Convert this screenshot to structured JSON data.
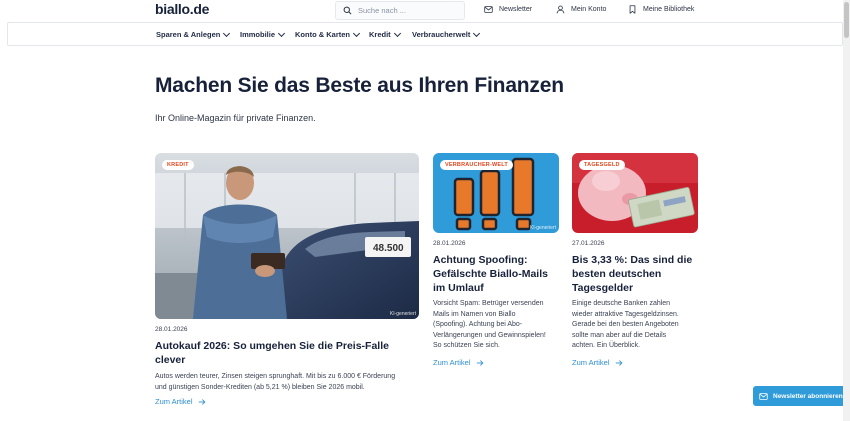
{
  "header": {
    "logo": "biallo.de",
    "search_placeholder": "Suche nach ...",
    "links": {
      "newsletter": "Newsletter",
      "account": "Mein Konto",
      "library": "Meine Bibliothek"
    }
  },
  "nav": {
    "items": [
      {
        "label": "Sparen & Anlegen"
      },
      {
        "label": "Immobilie"
      },
      {
        "label": "Konto & Karten"
      },
      {
        "label": "Kredit"
      },
      {
        "label": "Verbraucherwelt"
      }
    ]
  },
  "hero": {
    "title": "Machen Sie das Beste aus Ihren Finanzen",
    "subtitle": "Ihr Online-Magazin für private Finanzen."
  },
  "articles": [
    {
      "tag": "KREDIT",
      "credit": "KI-generiert",
      "plate": "48.500",
      "date": "28.01.2026",
      "title": "Autokauf 2026: So umgehen Sie die Preis-Falle clever",
      "title_line1": "Autokauf 2026: So umgehen Sie die Preis-Falle",
      "title_line2": "clever",
      "text_line1": "Autos werden teurer, Zinsen steigen sprunghaft. Mit bis zu 6.000 € Förderung",
      "text_line2": "und günstigen Sonder-Krediten (ab 5,21 %) bleiben Sie 2026 mobil.",
      "link": "Zum Artikel"
    },
    {
      "tag": "VERBRAUCHER-WELT",
      "credit": "KI-generiert",
      "date": "28.01.2026",
      "title_lines": [
        "Achtung Spoofing:",
        "Gefälschte Biallo-Mails",
        "im Umlauf"
      ],
      "text_lines": [
        "Vorsicht Spam: Betrüger versenden",
        "Mails im Namen von Biallo",
        "(Spoofing). Achtung bei Abo-",
        "Verlängerungen und Gewinnspielen!",
        "So schützen Sie sich."
      ],
      "link": "Zum Artikel"
    },
    {
      "tag": "TAGESGELD",
      "date": "27.01.2026",
      "title_lines": [
        "Bis 3,33 %: Das sind die",
        "besten deutschen",
        "Tagesgelder"
      ],
      "text_lines": [
        "Einige deutsche Banken zahlen",
        "wieder attraktive Tagesgeldzinsen.",
        "Gerade bei den besten Angeboten",
        "sollte man aber auf die Details",
        "achten. Ein Überblick."
      ],
      "link": "Zum Artikel"
    }
  ],
  "newsletter_button": "Newsletter abonnieren",
  "colors": {
    "brand_dark": "#17213a",
    "tag_text": "#e0481d",
    "link": "#2d8fd0",
    "newsletter_bg": "#2f9bd8"
  }
}
